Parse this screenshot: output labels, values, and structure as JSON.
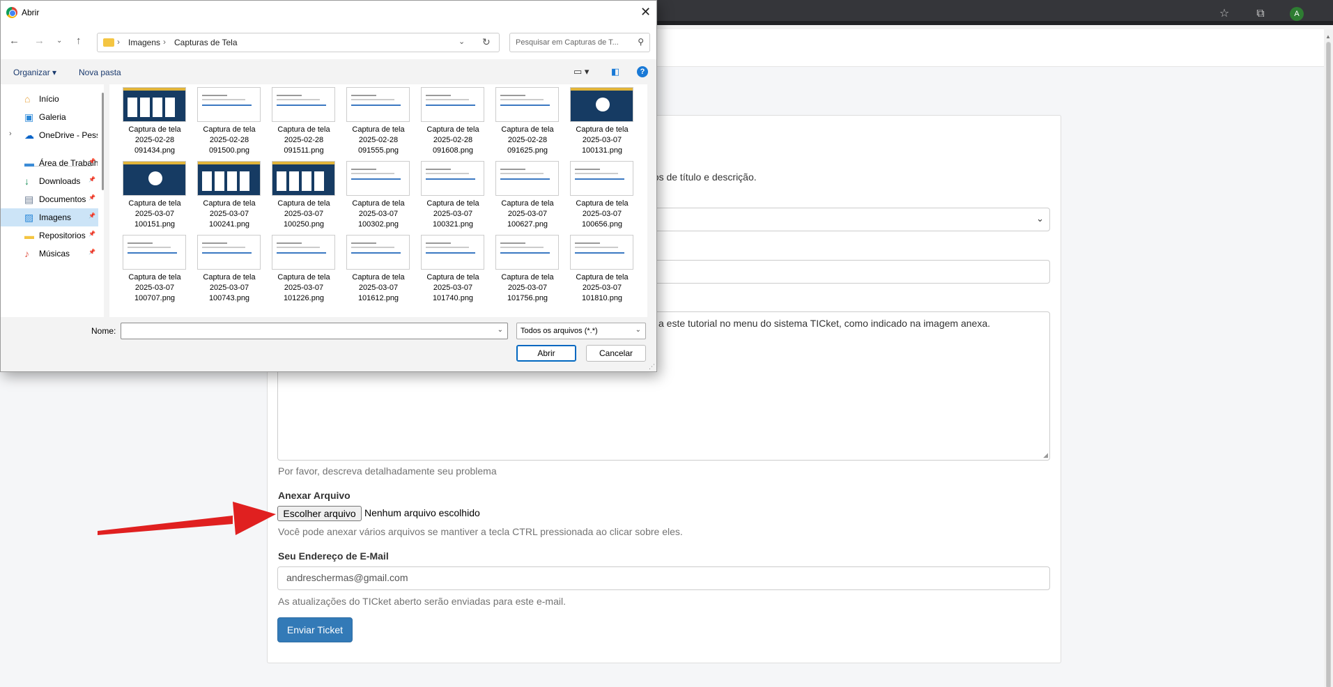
{
  "browser": {
    "avatar_letter": "A"
  },
  "page": {
    "partial_instructions": "pos de título e descrição.",
    "textarea_partial": "a este tutorial no menu do sistema TICket, como indicado na imagem anexa.",
    "textarea_help": "Por favor, descreva detalhadamente seu problema",
    "attach_label": "Anexar Arquivo",
    "file_button": "Escolher arquivo",
    "file_status": "Nenhum arquivo escolhido",
    "attach_help": "Você pode anexar vários arquivos se mantiver a tecla CTRL pressionada ao clicar sobre eles.",
    "email_label": "Seu Endereço de E-Mail",
    "email_value": "andreschermas@gmail.com",
    "email_help": "As atualizações do TICket aberto serão enviadas para este e-mail.",
    "submit_label": "Enviar Ticket"
  },
  "dialog": {
    "title": "Abrir",
    "breadcrumb": [
      "Imagens",
      "Capturas de Tela"
    ],
    "search_placeholder": "Pesquisar em Capturas de T...",
    "organize": "Organizar",
    "new_folder": "Nova pasta",
    "nav_items": [
      {
        "label": "Início",
        "icon": "home-icon",
        "color": "#e8a33d",
        "pinned": false
      },
      {
        "label": "Galeria",
        "icon": "gallery-icon",
        "color": "#2b88d8",
        "pinned": false
      },
      {
        "label": "OneDrive - Pessoal",
        "icon": "onedrive-icon",
        "color": "#0a64c8",
        "pinned": false
      },
      {
        "label": "Área de Trabalho",
        "icon": "desktop-icon",
        "color": "#3a8bd6",
        "pinned": true
      },
      {
        "label": "Downloads",
        "icon": "download-icon",
        "color": "#1a8f5a",
        "pinned": true
      },
      {
        "label": "Documentos",
        "icon": "documents-icon",
        "color": "#6b7c93",
        "pinned": true
      },
      {
        "label": "Imagens",
        "icon": "pictures-icon",
        "color": "#2b88d8",
        "pinned": true
      },
      {
        "label": "Repositorios",
        "icon": "folder-icon",
        "color": "#f4c542",
        "pinned": true
      },
      {
        "label": "Músicas",
        "icon": "music-icon",
        "color": "#e0584a",
        "pinned": true
      }
    ],
    "files": [
      {
        "line1": "Captura de tela",
        "line2": "2025-02-28",
        "line3": "091434.png",
        "style": "dark"
      },
      {
        "line1": "Captura de tela",
        "line2": "2025-02-28",
        "line3": "091500.png",
        "style": "light"
      },
      {
        "line1": "Captura de tela",
        "line2": "2025-02-28",
        "line3": "091511.png",
        "style": "light"
      },
      {
        "line1": "Captura de tela",
        "line2": "2025-02-28",
        "line3": "091555.png",
        "style": "light"
      },
      {
        "line1": "Captura de tela",
        "line2": "2025-02-28",
        "line3": "091608.png",
        "style": "light"
      },
      {
        "line1": "Captura de tela",
        "line2": "2025-02-28",
        "line3": "091625.png",
        "style": "light"
      },
      {
        "line1": "Captura de tela",
        "line2": "2025-03-07",
        "line3": "100131.png",
        "style": "disc"
      },
      {
        "line1": "Captura de tela",
        "line2": "2025-03-07",
        "line3": "100151.png",
        "style": "disc"
      },
      {
        "line1": "Captura de tela",
        "line2": "2025-03-07",
        "line3": "100241.png",
        "style": "dark"
      },
      {
        "line1": "Captura de tela",
        "line2": "2025-03-07",
        "line3": "100250.png",
        "style": "dark"
      },
      {
        "line1": "Captura de tela",
        "line2": "2025-03-07",
        "line3": "100302.png",
        "style": "light"
      },
      {
        "line1": "Captura de tela",
        "line2": "2025-03-07",
        "line3": "100321.png",
        "style": "light"
      },
      {
        "line1": "Captura de tela",
        "line2": "2025-03-07",
        "line3": "100627.png",
        "style": "light"
      },
      {
        "line1": "Captura de tela",
        "line2": "2025-03-07",
        "line3": "100656.png",
        "style": "light"
      },
      {
        "line1": "Captura de tela",
        "line2": "2025-03-07",
        "line3": "100707.png",
        "style": "light"
      },
      {
        "line1": "Captura de tela",
        "line2": "2025-03-07",
        "line3": "100743.png",
        "style": "light"
      },
      {
        "line1": "Captura de tela",
        "line2": "2025-03-07",
        "line3": "101226.png",
        "style": "light"
      },
      {
        "line1": "Captura de tela",
        "line2": "2025-03-07",
        "line3": "101612.png",
        "style": "light"
      },
      {
        "line1": "Captura de tela",
        "line2": "2025-03-07",
        "line3": "101740.png",
        "style": "light"
      },
      {
        "line1": "Captura de tela",
        "line2": "2025-03-07",
        "line3": "101756.png",
        "style": "light"
      },
      {
        "line1": "Captura de tela",
        "line2": "2025-03-07",
        "line3": "101810.png",
        "style": "light"
      }
    ],
    "name_label": "Nome:",
    "name_value": "",
    "file_type": "Todos os arquivos (*.*)",
    "open_button": "Abrir",
    "cancel_button": "Cancelar"
  },
  "colors": {
    "annotation_arrow": "#e02020",
    "submit": "#337ab7",
    "accent": "#0067c0"
  }
}
